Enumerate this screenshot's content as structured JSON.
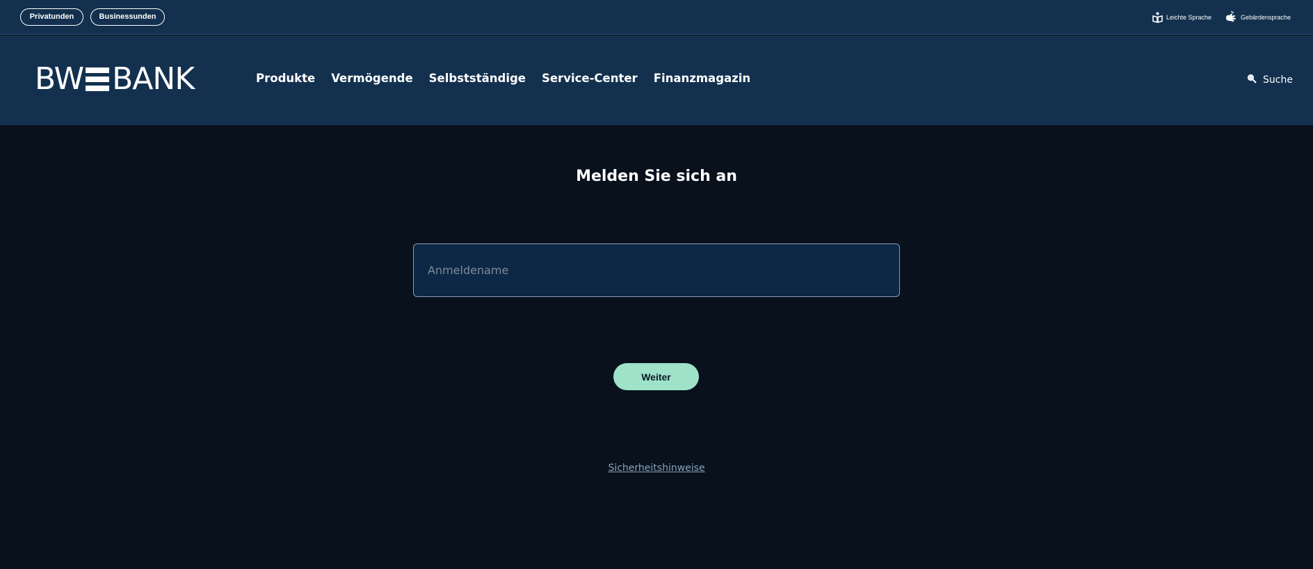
{
  "topbar": {
    "segments": [
      {
        "label": "Privatunden"
      },
      {
        "label": "Businessunden"
      }
    ],
    "utilities": {
      "leichte_sprache": "Leichte Sprache",
      "gebaerdensprache": "Gebärdensprache"
    }
  },
  "header": {
    "logo": {
      "left": "BW",
      "right": "BANK"
    },
    "nav": [
      {
        "label": "Produkte"
      },
      {
        "label": "Vermögende"
      },
      {
        "label": "Selbstständige"
      },
      {
        "label": "Service-Center"
      },
      {
        "label": "Finanzmagazin"
      }
    ],
    "search_label": "Suche",
    "search_icon": "magnifier-icon"
  },
  "login": {
    "title": "Melden Sie sich an",
    "username_placeholder": "Anmeldename",
    "username_value": "",
    "submit_label": "Weiter",
    "security_link": "Sicherheitshinweise"
  },
  "colors": {
    "header_bg": "#13314f",
    "page_bg": "#08111c",
    "field_bg": "#0d2846",
    "accent": "#9de2c9",
    "link": "#8aa2bb"
  }
}
